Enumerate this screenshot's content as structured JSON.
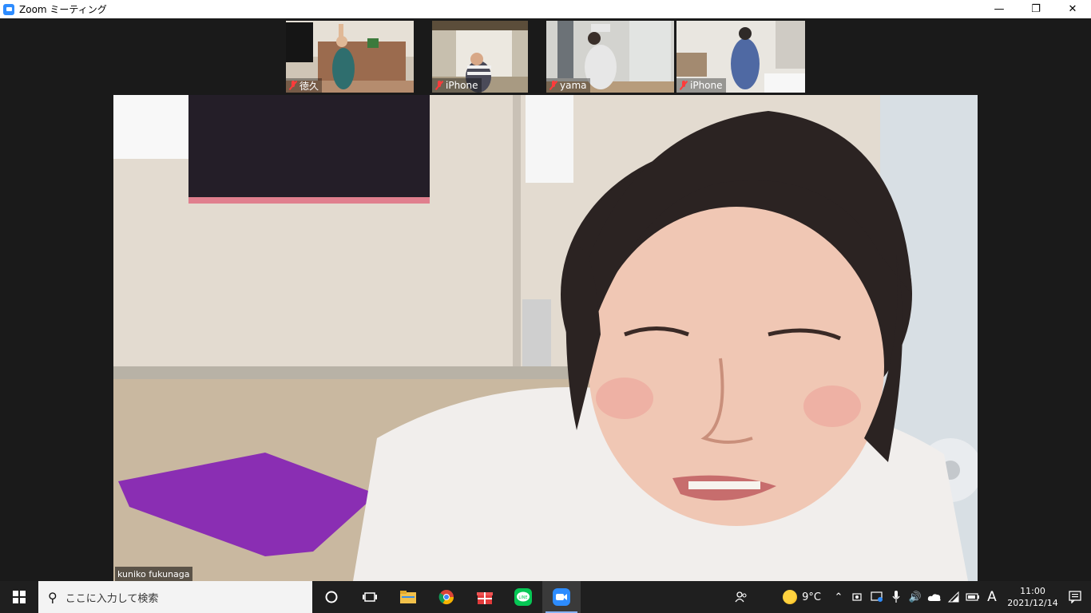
{
  "window": {
    "title": "Zoom ミーティング",
    "minimize_glyph": "—",
    "restore_glyph": "❐",
    "close_glyph": "✕"
  },
  "participants": [
    {
      "name": "徳久",
      "muted": true
    },
    {
      "name": "iPhone",
      "muted": true
    },
    {
      "name": "yama",
      "muted": true
    },
    {
      "name": "iPhone",
      "muted": true
    }
  ],
  "active_speaker": {
    "name": "kuniko fukunaga"
  },
  "taskbar": {
    "search_placeholder": "ここに入力して検索",
    "pinned_apps": [
      "cortana-icon",
      "task-view-icon",
      "file-explorer-icon",
      "chrome-icon",
      "gift-icon",
      "line-icon",
      "zoom-icon"
    ],
    "line_label": "LINE",
    "weather": {
      "temp": "9°C",
      "icon": "partly-sunny-icon"
    },
    "ime": "A",
    "time": "11:00",
    "date": "2021/12/14"
  },
  "colors": {
    "zoom_blue": "#2d8cff",
    "muted_red": "#ff3b3b",
    "taskbar": "#1f1f1f"
  }
}
